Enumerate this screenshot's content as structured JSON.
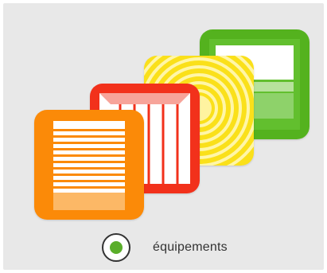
{
  "colors": {
    "panel_background": "#e8e8e8",
    "green_tile": "#54b21e",
    "yellow_tile": "#fae01a",
    "red_tile": "#f2311b",
    "orange_tile": "#fb8a08",
    "radio_selected": "#5aae2a"
  },
  "tiles": [
    {
      "icon": "roof-window-icon",
      "color": "green"
    },
    {
      "icon": "concentric-rings-icon",
      "color": "yellow"
    },
    {
      "icon": "door-panels-icon",
      "color": "red"
    },
    {
      "icon": "striped-shutter-icon",
      "color": "orange"
    }
  ],
  "filter": {
    "label": "équipements",
    "selected": true
  }
}
